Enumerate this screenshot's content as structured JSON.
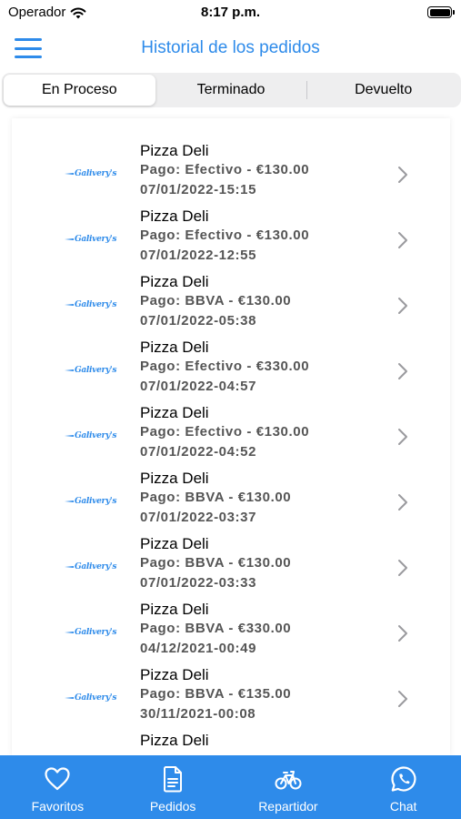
{
  "status_bar": {
    "carrier": "Operador",
    "time": "8:17 p.m."
  },
  "header": {
    "title": "Historial de los pedidos"
  },
  "segments": [
    {
      "label": "En Proceso",
      "selected": true
    },
    {
      "label": "Terminado",
      "selected": false
    },
    {
      "label": "Devuelto",
      "selected": false
    }
  ],
  "orders": [
    {
      "logo_text": "Galivery's",
      "name": "Pizza Deli",
      "payment": "Pago: Efectivo - €130.00",
      "date": "07/01/2022-15:15"
    },
    {
      "logo_text": "Galivery's",
      "name": "Pizza Deli",
      "payment": "Pago: Efectivo - €130.00",
      "date": "07/01/2022-12:55"
    },
    {
      "logo_text": "Galivery's",
      "name": "Pizza Deli",
      "payment": "Pago: BBVA - €130.00",
      "date": "07/01/2022-05:38"
    },
    {
      "logo_text": "Galivery's",
      "name": "Pizza Deli",
      "payment": "Pago: Efectivo - €330.00",
      "date": "07/01/2022-04:57"
    },
    {
      "logo_text": "Galivery's",
      "name": "Pizza Deli",
      "payment": "Pago: Efectivo - €130.00",
      "date": "07/01/2022-04:52"
    },
    {
      "logo_text": "Galivery's",
      "name": "Pizza Deli",
      "payment": "Pago: BBVA - €130.00",
      "date": "07/01/2022-03:37"
    },
    {
      "logo_text": "Galivery's",
      "name": "Pizza Deli",
      "payment": "Pago: BBVA - €130.00",
      "date": "07/01/2022-03:33"
    },
    {
      "logo_text": "Galivery's",
      "name": "Pizza Deli",
      "payment": "Pago: BBVA - €330.00",
      "date": "04/12/2021-00:49"
    },
    {
      "logo_text": "Galivery's",
      "name": "Pizza Deli",
      "payment": "Pago: BBVA - €135.00",
      "date": "30/11/2021-00:08"
    },
    {
      "logo_text": "",
      "name": "Pizza Deli",
      "payment": "",
      "date": ""
    }
  ],
  "tabbar": {
    "items": [
      {
        "label": "Favoritos",
        "icon": "heart-icon"
      },
      {
        "label": "Pedidos",
        "icon": "document-icon"
      },
      {
        "label": "Repartidor",
        "icon": "bicycle-icon"
      },
      {
        "label": "Chat",
        "icon": "whatsapp-icon"
      }
    ]
  },
  "colors": {
    "accent": "#2e8bea",
    "muted_text": "#555555",
    "segment_bg": "#eeeeef"
  }
}
